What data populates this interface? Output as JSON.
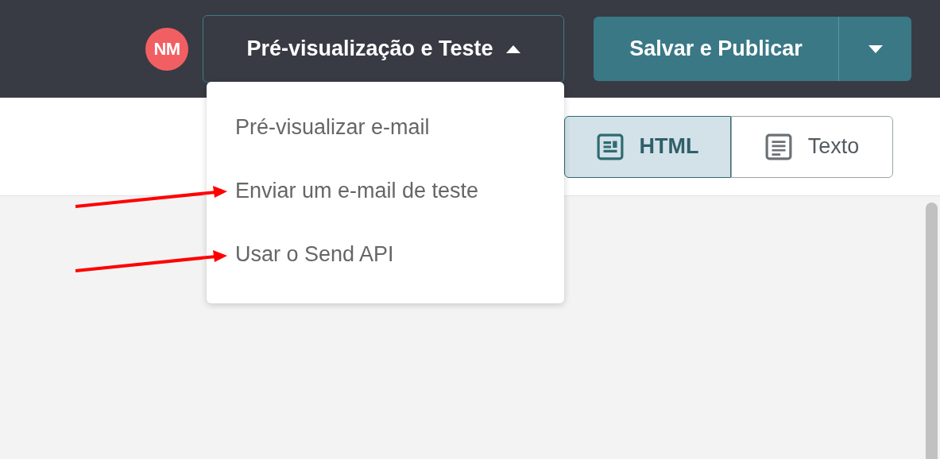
{
  "header": {
    "avatar": "NM",
    "preview_menu": {
      "label": "Pré-visualização e Teste",
      "expanded": true,
      "items": [
        {
          "label": "Pré-visualizar e-mail",
          "marked": false
        },
        {
          "label": "Enviar um e-mail de teste",
          "marked": true
        },
        {
          "label": "Usar o Send API",
          "marked": true
        }
      ]
    },
    "save_button": "Salvar e Publicar"
  },
  "view_toggle": [
    {
      "label": "HTML",
      "kind": "html",
      "selected": true
    },
    {
      "label": "Texto",
      "kind": "text",
      "selected": false
    }
  ]
}
